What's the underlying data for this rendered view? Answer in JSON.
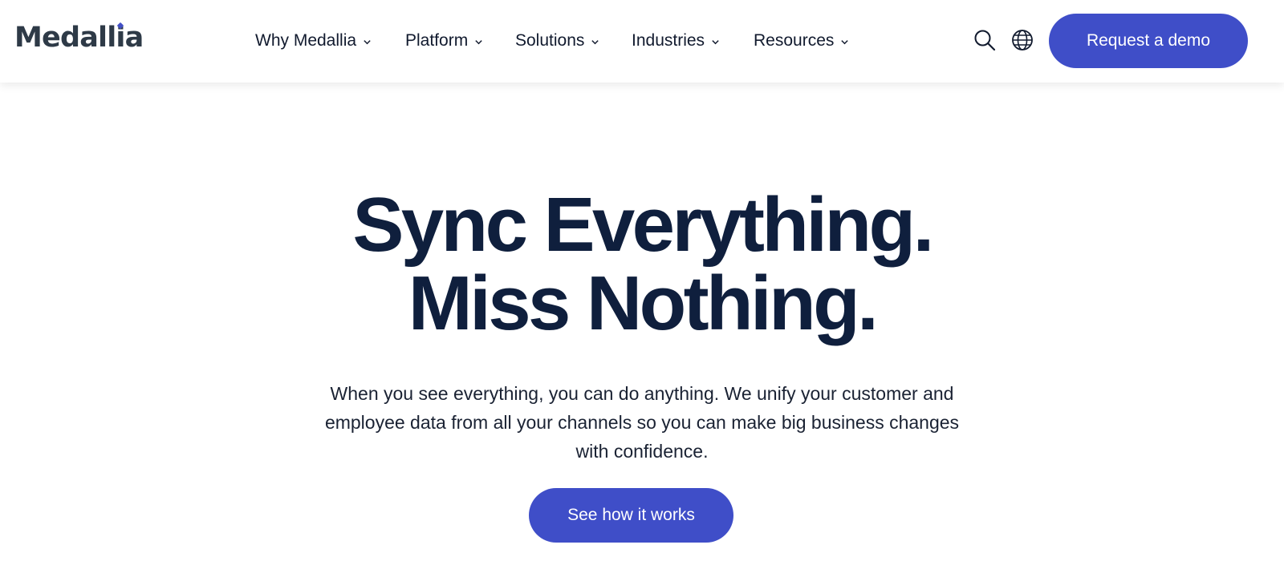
{
  "brand": {
    "logo_text": "Medallia",
    "accent_color": "#3f4ec8"
  },
  "nav": {
    "items": [
      {
        "label": "Why Medallia",
        "icon": "chevron-down-icon"
      },
      {
        "label": "Platform",
        "icon": "chevron-down-icon"
      },
      {
        "label": "Solutions",
        "icon": "chevron-down-icon"
      },
      {
        "label": "Industries",
        "icon": "chevron-down-icon"
      },
      {
        "label": "Resources",
        "icon": "chevron-down-icon"
      }
    ],
    "search_icon": "search-icon",
    "language_icon": "globe-icon",
    "demo_label": "Request a demo"
  },
  "hero": {
    "title_line1": "Sync Everything.",
    "title_line2": "Miss Nothing.",
    "subtitle": "When you see everything, you can do anything. We unify your customer and employee data from all your channels so you can make big business changes with confidence.",
    "cta_label": "See how it works"
  }
}
